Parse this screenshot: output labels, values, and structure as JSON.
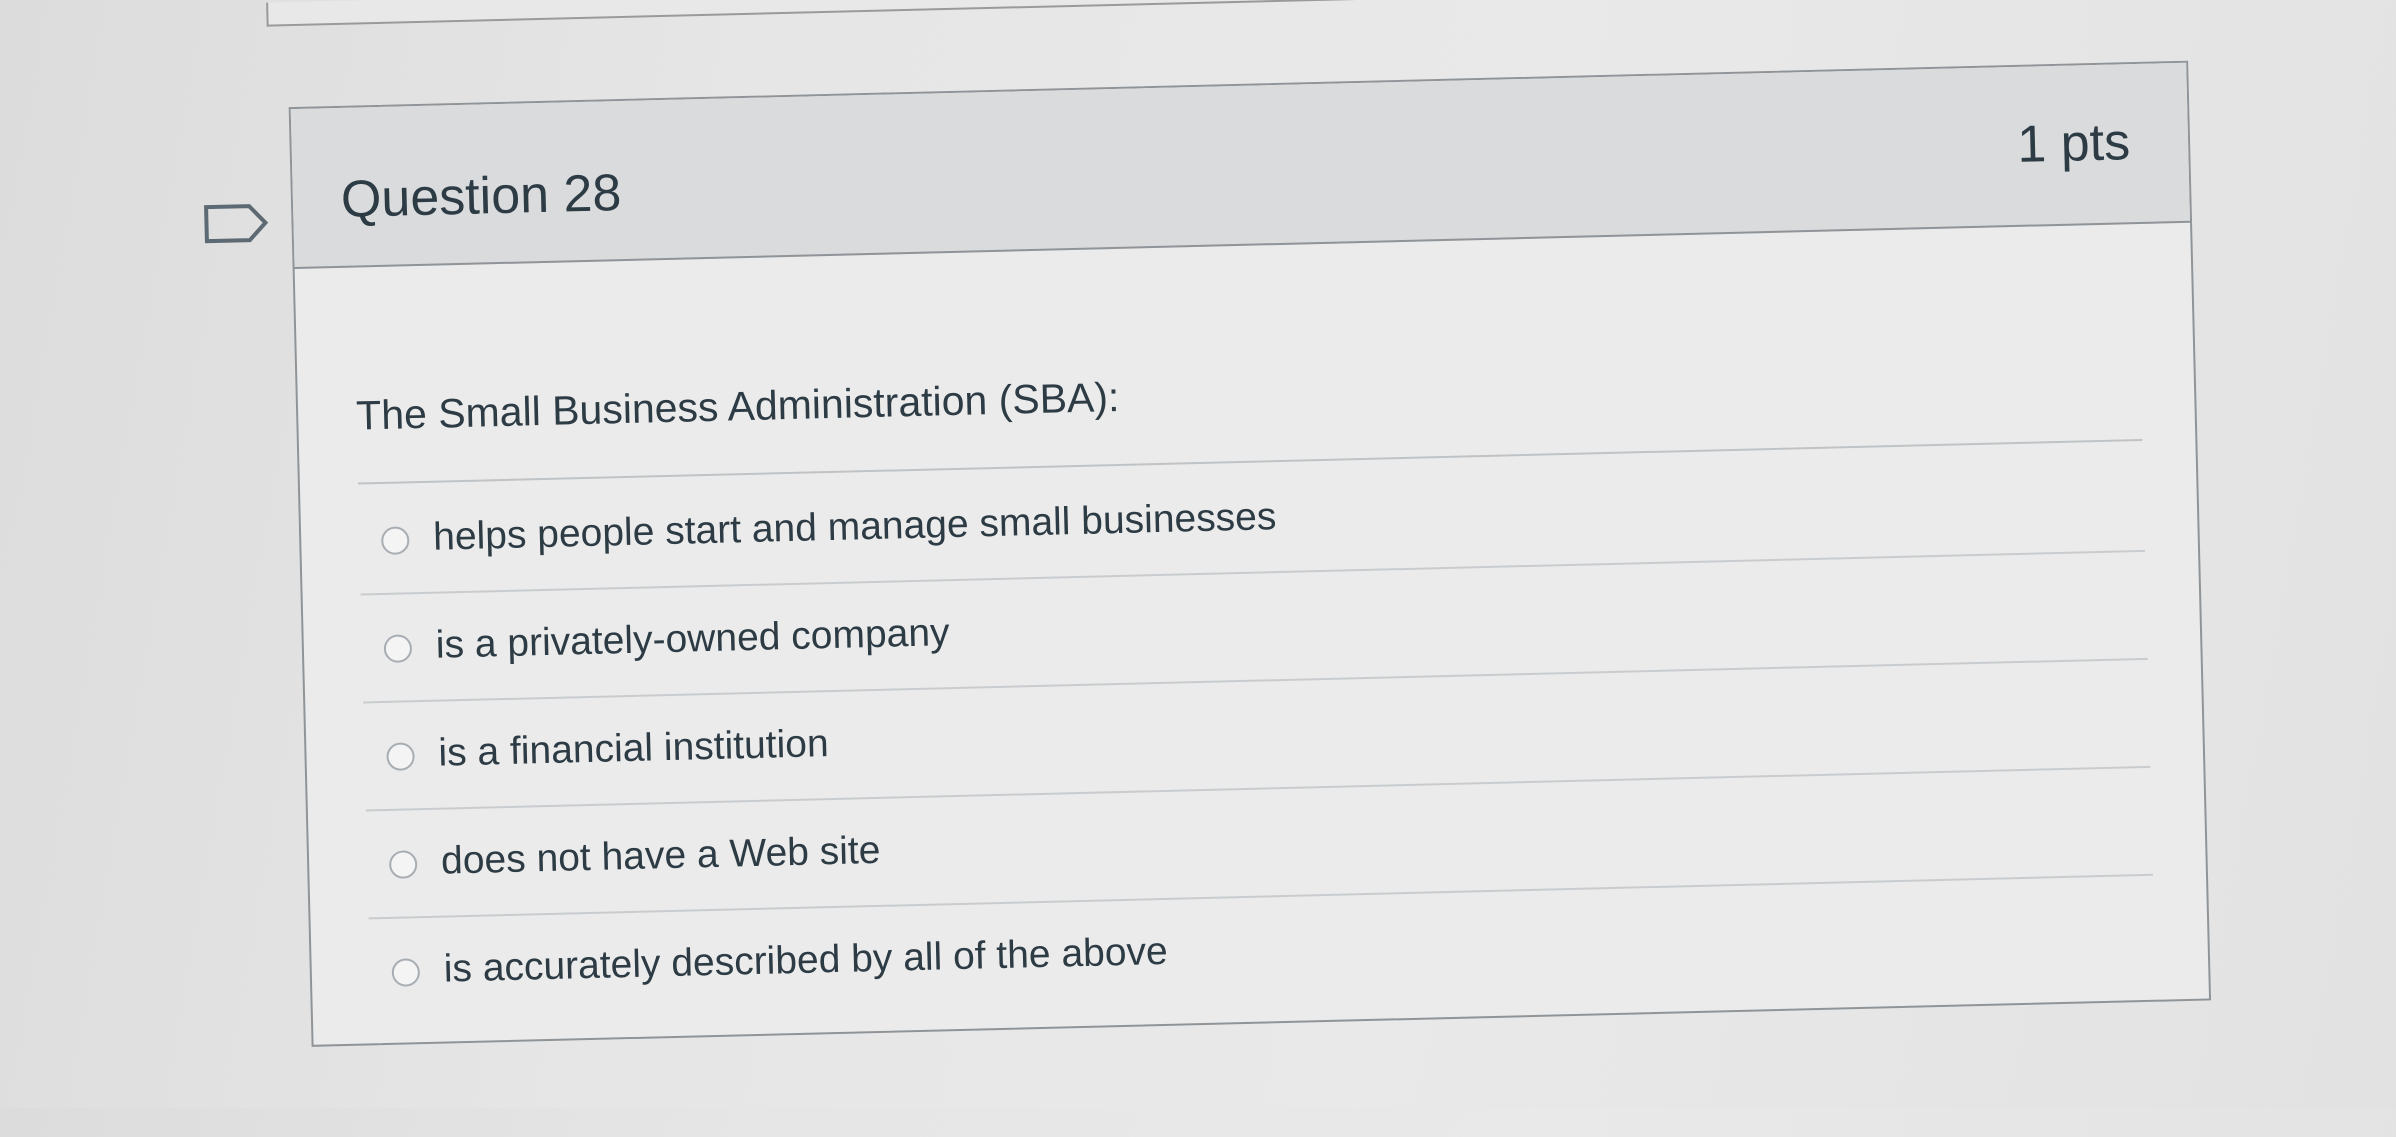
{
  "question": {
    "title": "Question 28",
    "points": "1 pts",
    "flag_icon": "bookmark-flag-icon",
    "text": "The Small Business Administration (SBA):",
    "answers": [
      {
        "label": "helps people start and manage small businesses",
        "selected": false
      },
      {
        "label": "is a privately-owned company",
        "selected": false
      },
      {
        "label": "is a financial institution",
        "selected": false
      },
      {
        "label": "does not have a Web site",
        "selected": false
      },
      {
        "label": "is accurately described by all of the above",
        "selected": false
      }
    ]
  },
  "colors": {
    "header_background": "#dadbdc",
    "card_border": "#8f9499",
    "text": "#2d3b45",
    "radio_border": "#a7adb2"
  }
}
